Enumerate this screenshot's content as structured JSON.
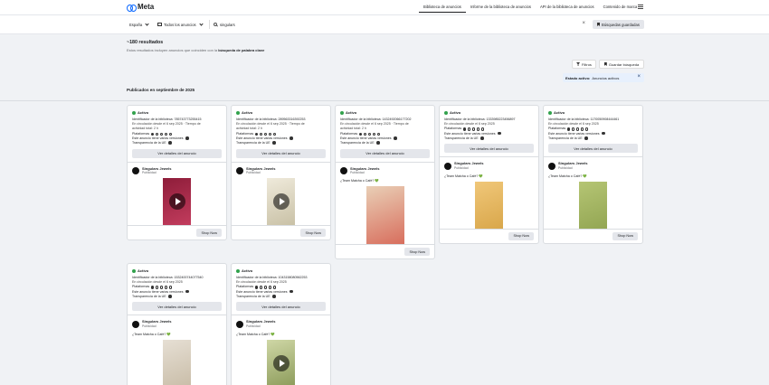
{
  "brand": {
    "name": "Meta",
    "accent": "#0866ff"
  },
  "nav": {
    "items": [
      "Biblioteca de anuncios",
      "Informe de la biblioteca de anuncios",
      "API de la biblioteca de anuncios",
      "Contenido de marca"
    ],
    "active_index": 0
  },
  "filters": {
    "country": "España",
    "ad_type": "Todos los anuncios",
    "search_value": "singulars",
    "saved_searches_label": "Búsquedas guardadas"
  },
  "results": {
    "count_label": "~180 resultados",
    "subtitle_pre": "Estos resultados incluyen anuncios que coinciden con la",
    "subtitle_bold": "búsqueda de palabra clave",
    "filters_btn": "Filtros",
    "save_search_btn": "Guardar búsqueda",
    "chip_label": "Estado activo:",
    "chip_value": "Anuncios activos"
  },
  "section_title": "Publicados en septiembre de 2025",
  "labels": {
    "status": "Activo",
    "platforms": "Plataformas",
    "multi_versions": "Este anuncio tiene varias versiones",
    "transparency": "Transparencia de la UE",
    "details_btn": "Ver detalles del anuncio",
    "advertiser": "Singulars Jewels",
    "sponsored": "Publicidad",
    "cta": "Shop Now"
  },
  "cards": [
    {
      "id": "Identificador de la biblioteca: 785743773255415",
      "date": "En circulación desde el 6 sep 2025 · Tiempo de",
      "date2": "actividad total: 2 h",
      "copy": "",
      "multi": true,
      "colors": [
        "#8e1d3a",
        "#c23c5d"
      ]
    },
    {
      "id": "Identificador de la biblioteca: 289563316392253",
      "date": "En circulación desde el 6 sep 2025 · Tiempo de",
      "date2": "actividad total: 2 h",
      "copy": "",
      "multi": true,
      "colors": [
        "#efeadb",
        "#c9c1a6"
      ]
    },
    {
      "id": "Identificador de la biblioteca: 1432492066177202",
      "date": "En circulación desde el 6 sep 2025 · Tiempo de",
      "date2": "actividad total: 2 h",
      "copy": "¿Team Matcha o Café? 💚",
      "multi": true,
      "colors": [
        "#e9cfb6",
        "#d86e5d"
      ]
    },
    {
      "id": "Identificador de la biblioteca: 1333985223456897",
      "date": "En circulación desde el 6 sep 2025",
      "date2": "",
      "copy": "¿Team Matcha o Café? 💚",
      "multi": true,
      "colors": [
        "#f0c779",
        "#d9a74b"
      ]
    },
    {
      "id": "Identificador de la biblioteca: 1170050908444461",
      "date": "En circulación desde el 6 sep 2025",
      "date2": "",
      "copy": "¿Team Matcha o Café? 💚",
      "multi": true,
      "colors": [
        "#b5c574",
        "#93a653"
      ]
    },
    {
      "id": "Identificador de la biblioteca: 1532400744077540",
      "date": "En circulación desde el 6 sep 2025",
      "date2": "",
      "copy": "¿Team Matcha o Café? 💚",
      "multi": true,
      "colors": [
        "#e6dfd4",
        "#c9bda8"
      ]
    },
    {
      "id": "Identificador de la biblioteca: 1043158080562253",
      "date": "En circulación desde el 6 sep 2025",
      "date2": "",
      "copy": "¿Team Matcha o Café? 💚",
      "multi": true,
      "colors": [
        "#cfd7a6",
        "#8c9b5a"
      ]
    }
  ]
}
